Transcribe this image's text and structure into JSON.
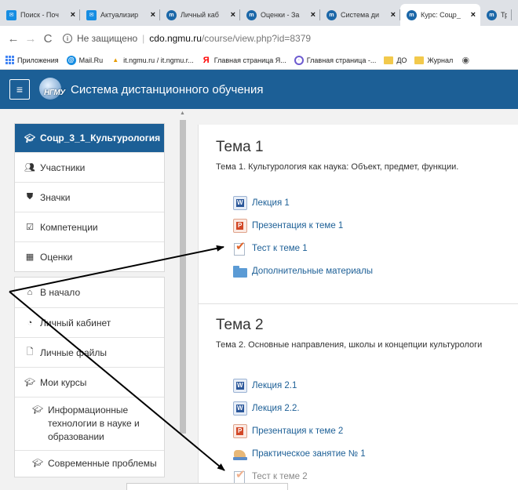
{
  "browser": {
    "tabs": [
      {
        "label": "Поиск - Поч",
        "icon": "mail-icon",
        "active": false
      },
      {
        "label": "Актуализир",
        "icon": "mail-icon",
        "active": false
      },
      {
        "label": "Личный каб",
        "icon": "moodle-icon",
        "active": false
      },
      {
        "label": "Оценки - За",
        "icon": "moodle-icon",
        "active": false
      },
      {
        "label": "Система ди",
        "icon": "moodle-icon",
        "active": false
      },
      {
        "label": "Курс: Соцр_",
        "icon": "moodle-icon",
        "active": true
      },
      {
        "label": "Тре",
        "icon": "moodle-icon",
        "active": false
      }
    ],
    "close_glyph": "×",
    "address": {
      "security": "Не защищено",
      "host": "cdo.ngmu.ru",
      "path": "/course/view.php?id=8379"
    },
    "bookmarks": [
      {
        "label": "Приложения",
        "icon": "apps-icon"
      },
      {
        "label": "Mail.Ru",
        "icon": "mailru-icon"
      },
      {
        "label": "it.ngmu.ru / it.ngmu.r...",
        "icon": "itngmu-icon"
      },
      {
        "label": "Главная страница Я...",
        "icon": "yandex-icon"
      },
      {
        "label": "Главная страница -...",
        "icon": "glav-icon"
      },
      {
        "label": "ДО",
        "icon": "folder-icon"
      },
      {
        "label": "Журнал",
        "icon": "folder-icon"
      }
    ]
  },
  "site": {
    "logo_text": "НГМУ",
    "name": "Система дистанционного обучения"
  },
  "drawer": {
    "course_group": [
      {
        "label": "Соцр_3_1_Культурология",
        "icon": "mortarboard-icon",
        "active": true
      },
      {
        "label": "Участники",
        "icon": "users-icon"
      },
      {
        "label": "Значки",
        "icon": "shield-icon"
      },
      {
        "label": "Компетенции",
        "icon": "checkbox-icon"
      },
      {
        "label": "Оценки",
        "icon": "table-icon"
      }
    ],
    "site_group": [
      {
        "label": "В начало",
        "icon": "home-icon"
      },
      {
        "label": "Личный кабинет",
        "icon": "dashboard-icon"
      },
      {
        "label": "Личные файлы",
        "icon": "file-icon"
      },
      {
        "label": "Мои курсы",
        "icon": "mortarboard-icon"
      },
      {
        "label": "Информационные технологии в науке и образовании",
        "icon": "mortarboard-icon"
      },
      {
        "label": "Современные проблемы",
        "icon": "mortarboard-icon"
      }
    ]
  },
  "sections": [
    {
      "title": "Тема 1",
      "summary": "Тема 1. Культурология как наука: Объект, предмет, функции.",
      "activities": [
        {
          "label": "Лекция 1",
          "type": "word"
        },
        {
          "label": "Презентация к теме 1",
          "type": "ppt"
        },
        {
          "label": "Тест к теме 1",
          "type": "quiz"
        },
        {
          "label": "Дополнительные материалы",
          "type": "folder"
        }
      ]
    },
    {
      "title": "Тема 2",
      "summary": "Тема 2. Основные направления, школы и концепции культурологи",
      "activities": [
        {
          "label": "Лекция 2.1",
          "type": "word"
        },
        {
          "label": "Лекция 2.2.",
          "type": "word"
        },
        {
          "label": "Презентация к теме 2",
          "type": "ppt"
        },
        {
          "label": "Практическое занятие № 1",
          "type": "hand"
        },
        {
          "label": "Тест к теме 2",
          "type": "quiz",
          "dimmed": true
        }
      ]
    }
  ],
  "colors": {
    "brand": "#1c5f96",
    "link": "#1c5f96",
    "annotation_arrow": "#000000"
  }
}
